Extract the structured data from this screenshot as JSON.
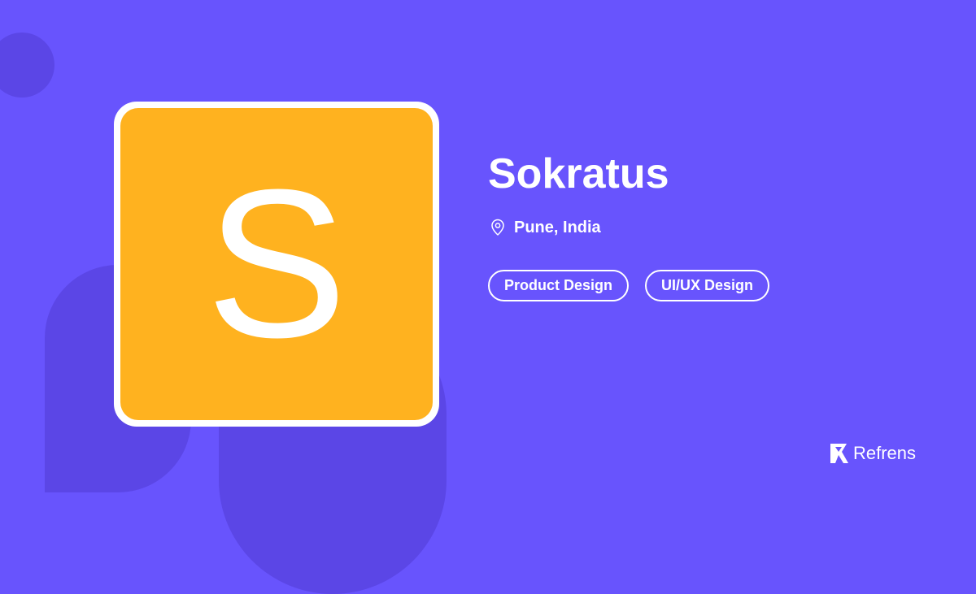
{
  "profile": {
    "initial": "S",
    "name": "Sokratus",
    "location": "Pune, India",
    "tags": [
      "Product Design",
      "UI/UX Design"
    ],
    "avatar_color": "#ffb21f"
  },
  "brand": {
    "name": "Refrens"
  },
  "colors": {
    "background": "#6854fd",
    "decor": "#5b46e6",
    "text": "#ffffff"
  },
  "icons": {
    "location": "location-pin-icon",
    "brand": "refrens-logo-icon"
  }
}
